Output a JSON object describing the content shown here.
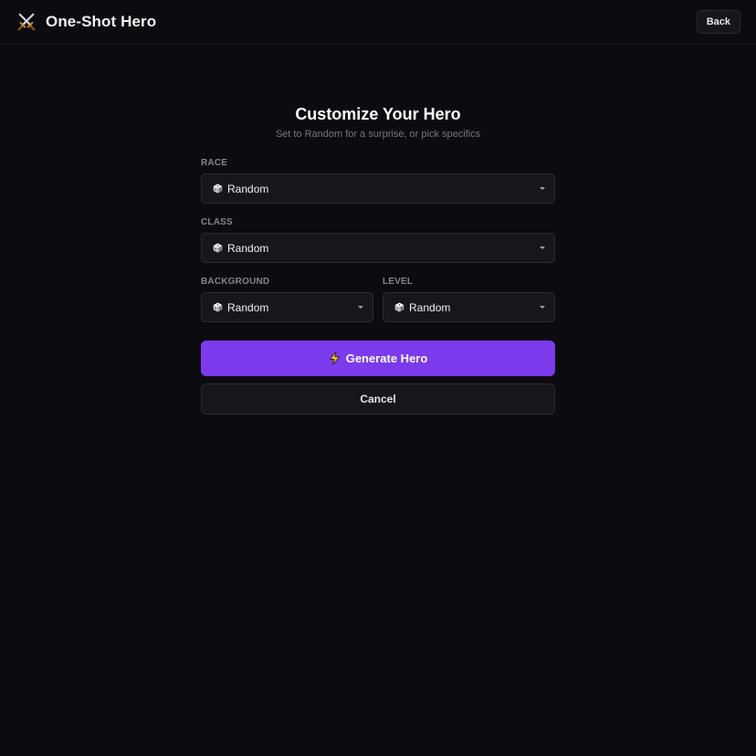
{
  "header": {
    "title": "One-Shot Hero",
    "logo_icon": "crossed-swords-icon",
    "back_label": "Back"
  },
  "main": {
    "title": "Customize Your Hero",
    "subtitle": "Set to Random for a surprise, or pick specifics",
    "fields": {
      "race": {
        "label": "RACE",
        "value": "Random",
        "icon": "dice-icon"
      },
      "class": {
        "label": "CLASS",
        "value": "Random",
        "icon": "dice-icon"
      },
      "background": {
        "label": "BACKGROUND",
        "value": "Random",
        "icon": "dice-icon"
      },
      "level": {
        "label": "LEVEL",
        "value": "Random",
        "icon": "dice-icon"
      }
    },
    "generate_label": "Generate Hero",
    "generate_icon": "lightning-icon",
    "cancel_label": "Cancel"
  },
  "colors": {
    "background": "#0c0b10",
    "accent": "#7c3aed",
    "surface": "#17161d",
    "border": "#2d2c34"
  }
}
